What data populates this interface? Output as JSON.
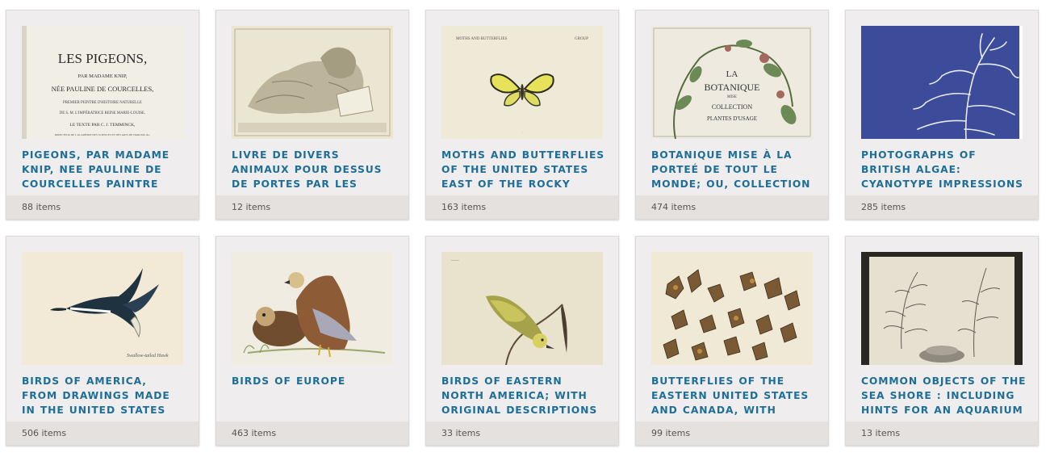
{
  "collections": [
    {
      "title": "PIGEONS, PAR MADAME KNIP, NEE PAULINE DE COURCELLES PAINTRE",
      "count": "88",
      "unit": "items",
      "cover": {
        "lines": [
          "LES PIGEONS,",
          "PAR MADAME KNIP,",
          "NÉE PAULINE DE COURCELLES,",
          "PREMIER PEINTRE D'HISTOIRE NATURELLE",
          "DE S. M. L'IMPÉRATRICE REINE MARIE-LOUISE.",
          "LE TEXTE PAR C. J. TEMMINCK,",
          "DIRECTEUR DE L'ACADÉMIE DES SCIENCES ET DES ARTS DE HARLEM, &c."
        ]
      }
    },
    {
      "title": "LIVRE DE DIVERS ANIMAUX POUR DESSUS DE PORTES PAR LES MEILLEURS",
      "count": "12",
      "unit": "items"
    },
    {
      "title": "MOTHS AND BUTTERFLIES OF THE UNITED STATES EAST OF THE ROCKY MOUNTAINS;",
      "count": "163",
      "unit": "items",
      "cover": {
        "header_left": "MOTHS AND BUTTERFLIES",
        "header_right": "GROUP"
      }
    },
    {
      "title": "BOTANIQUE MISE À LA PORTEÉ DE TOUT LE MONDE; OU, COLLECTION DES",
      "count": "474",
      "unit": "items",
      "cover": {
        "lines": [
          "LA",
          "BOTANIQUE",
          "MISE",
          "COLLECTION",
          "PLANTES D'USAGE"
        ]
      }
    },
    {
      "title": "PHOTOGRAPHS OF BRITISH ALGAE: CYANOTYPE IMPRESSIONS",
      "count": "285",
      "unit": "items"
    },
    {
      "title": "BIRDS OF AMERICA, FROM DRAWINGS MADE IN THE UNITED STATES AND THEIR",
      "count": "506",
      "unit": "items",
      "cover": {
        "caption": "Swallow-tailed Hawk"
      }
    },
    {
      "title": "BIRDS OF EUROPE",
      "count": "463",
      "unit": "items"
    },
    {
      "title": "BIRDS OF EASTERN NORTH AMERICA; WITH ORIGINAL DESCRIPTIONS OF ALL THE",
      "count": "33",
      "unit": "items"
    },
    {
      "title": "BUTTERFLIES OF THE EASTERN UNITED STATES AND CANADA, WITH SPECIAL",
      "count": "99",
      "unit": "items"
    },
    {
      "title": "COMMON OBJECTS OF THE SEA SHORE : INCLUDING HINTS FOR AN AQUARIUM",
      "count": "13",
      "unit": "items"
    }
  ]
}
